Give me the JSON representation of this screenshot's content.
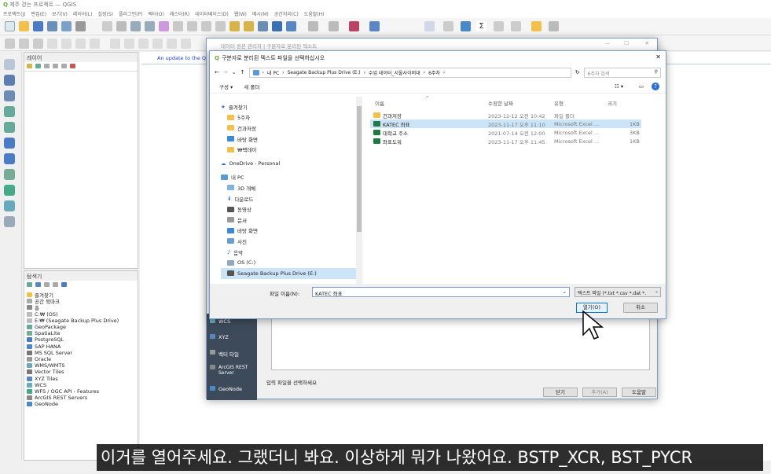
{
  "qgis": {
    "title": "제주 걷는 프로젝트 — QGIS",
    "menu": [
      "프로젝트(J)",
      "편집(E)",
      "보기(V)",
      "레이어(L)",
      "설정(S)",
      "플러그인(P)",
      "벡터(O)",
      "래스터(R)",
      "데이터베이스(D)",
      "웹(W)",
      "메시(M)",
      "공간처리(C)",
      "도움말(H)"
    ],
    "layers_panel": "레이어",
    "browser_panel": "탐색기",
    "browser_items": [
      "즐겨찾기",
      "공간 북마크",
      "홈",
      "C:₩ (OS)",
      "E:₩ (Seagate Backup Plus Drive)",
      "GeoPackage",
      "SpatiaLite",
      "PostgreSQL",
      "SAP HANA",
      "MS SQL Server",
      "Oracle",
      "WMS/WMTS",
      "Vector Tiles",
      "XYZ Tiles",
      "WCS",
      "WFS / OGC API - Features",
      "ArcGIS REST Servers",
      "GeoNode"
    ],
    "update_notice": "An update to the Q"
  },
  "datasource_manager": {
    "title": "데이터 원본 관리자 | 구분자로 분리된 텍스트",
    "left_items": [
      "WCS",
      "XYZ",
      "벡터 타일",
      "ArcGIS REST Server",
      "GeoNode"
    ],
    "status_text": "입력 파일을 선택하세요",
    "btn_close": "닫기",
    "btn_add": "추가(A)",
    "btn_help": "도움말"
  },
  "file_dialog": {
    "title": "구분자로 분리된 텍스트 파일을 선택하십시오",
    "breadcrumb": [
      "내 PC",
      "Seagate Backup Plus Drive (E:)",
      "수업 데이터_서울사이버대",
      "6주차"
    ],
    "search_placeholder": "6주차 검색",
    "organize": "구성 ▾",
    "new_folder": "새 폴더",
    "nav_items": [
      "즐겨찾기",
      "5주차",
      "건과저장",
      "바탕 화면",
      "₩백데이",
      "OneDrive - Personal",
      "내 PC",
      "3D 개체",
      "다운로드",
      "동영상",
      "문서",
      "바탕 화면",
      "사진",
      "음악",
      "OS (C:)",
      "Seagate Backup Plus Drive (E:)"
    ],
    "columns": [
      "이름",
      "수정한 날짜",
      "유형",
      "크기"
    ],
    "files": [
      {
        "name": "건과저장",
        "date": "2023-12-12 오전 10:42",
        "type": "파일 폴더",
        "size": ""
      },
      {
        "name": "KATEC 좌표",
        "date": "2023-11-17 오후 11:10",
        "type": "Microsoft Excel ...",
        "size": "1KB"
      },
      {
        "name": "대학교 주소",
        "date": "2021-07-14 오전 12:00",
        "type": "Microsoft Excel ...",
        "size": "3KB"
      },
      {
        "name": "좌표도워",
        "date": "2023-11-17 오후 11:45",
        "type": "Microsoft Excel ...",
        "size": "1KB"
      }
    ],
    "filename_label": "파일 이름(N):",
    "filename_value": "KATEC 좌표",
    "filetype": "텍스트 파일 (*.txt *.csv *.dat *.",
    "btn_open": "열기(O)",
    "btn_cancel": "취소"
  },
  "caption": "이거를 열어주세요. 그랬더니 봐요. 이상하게 뭐가 나왔어요. BSTP_XCR, BST_PYCR"
}
